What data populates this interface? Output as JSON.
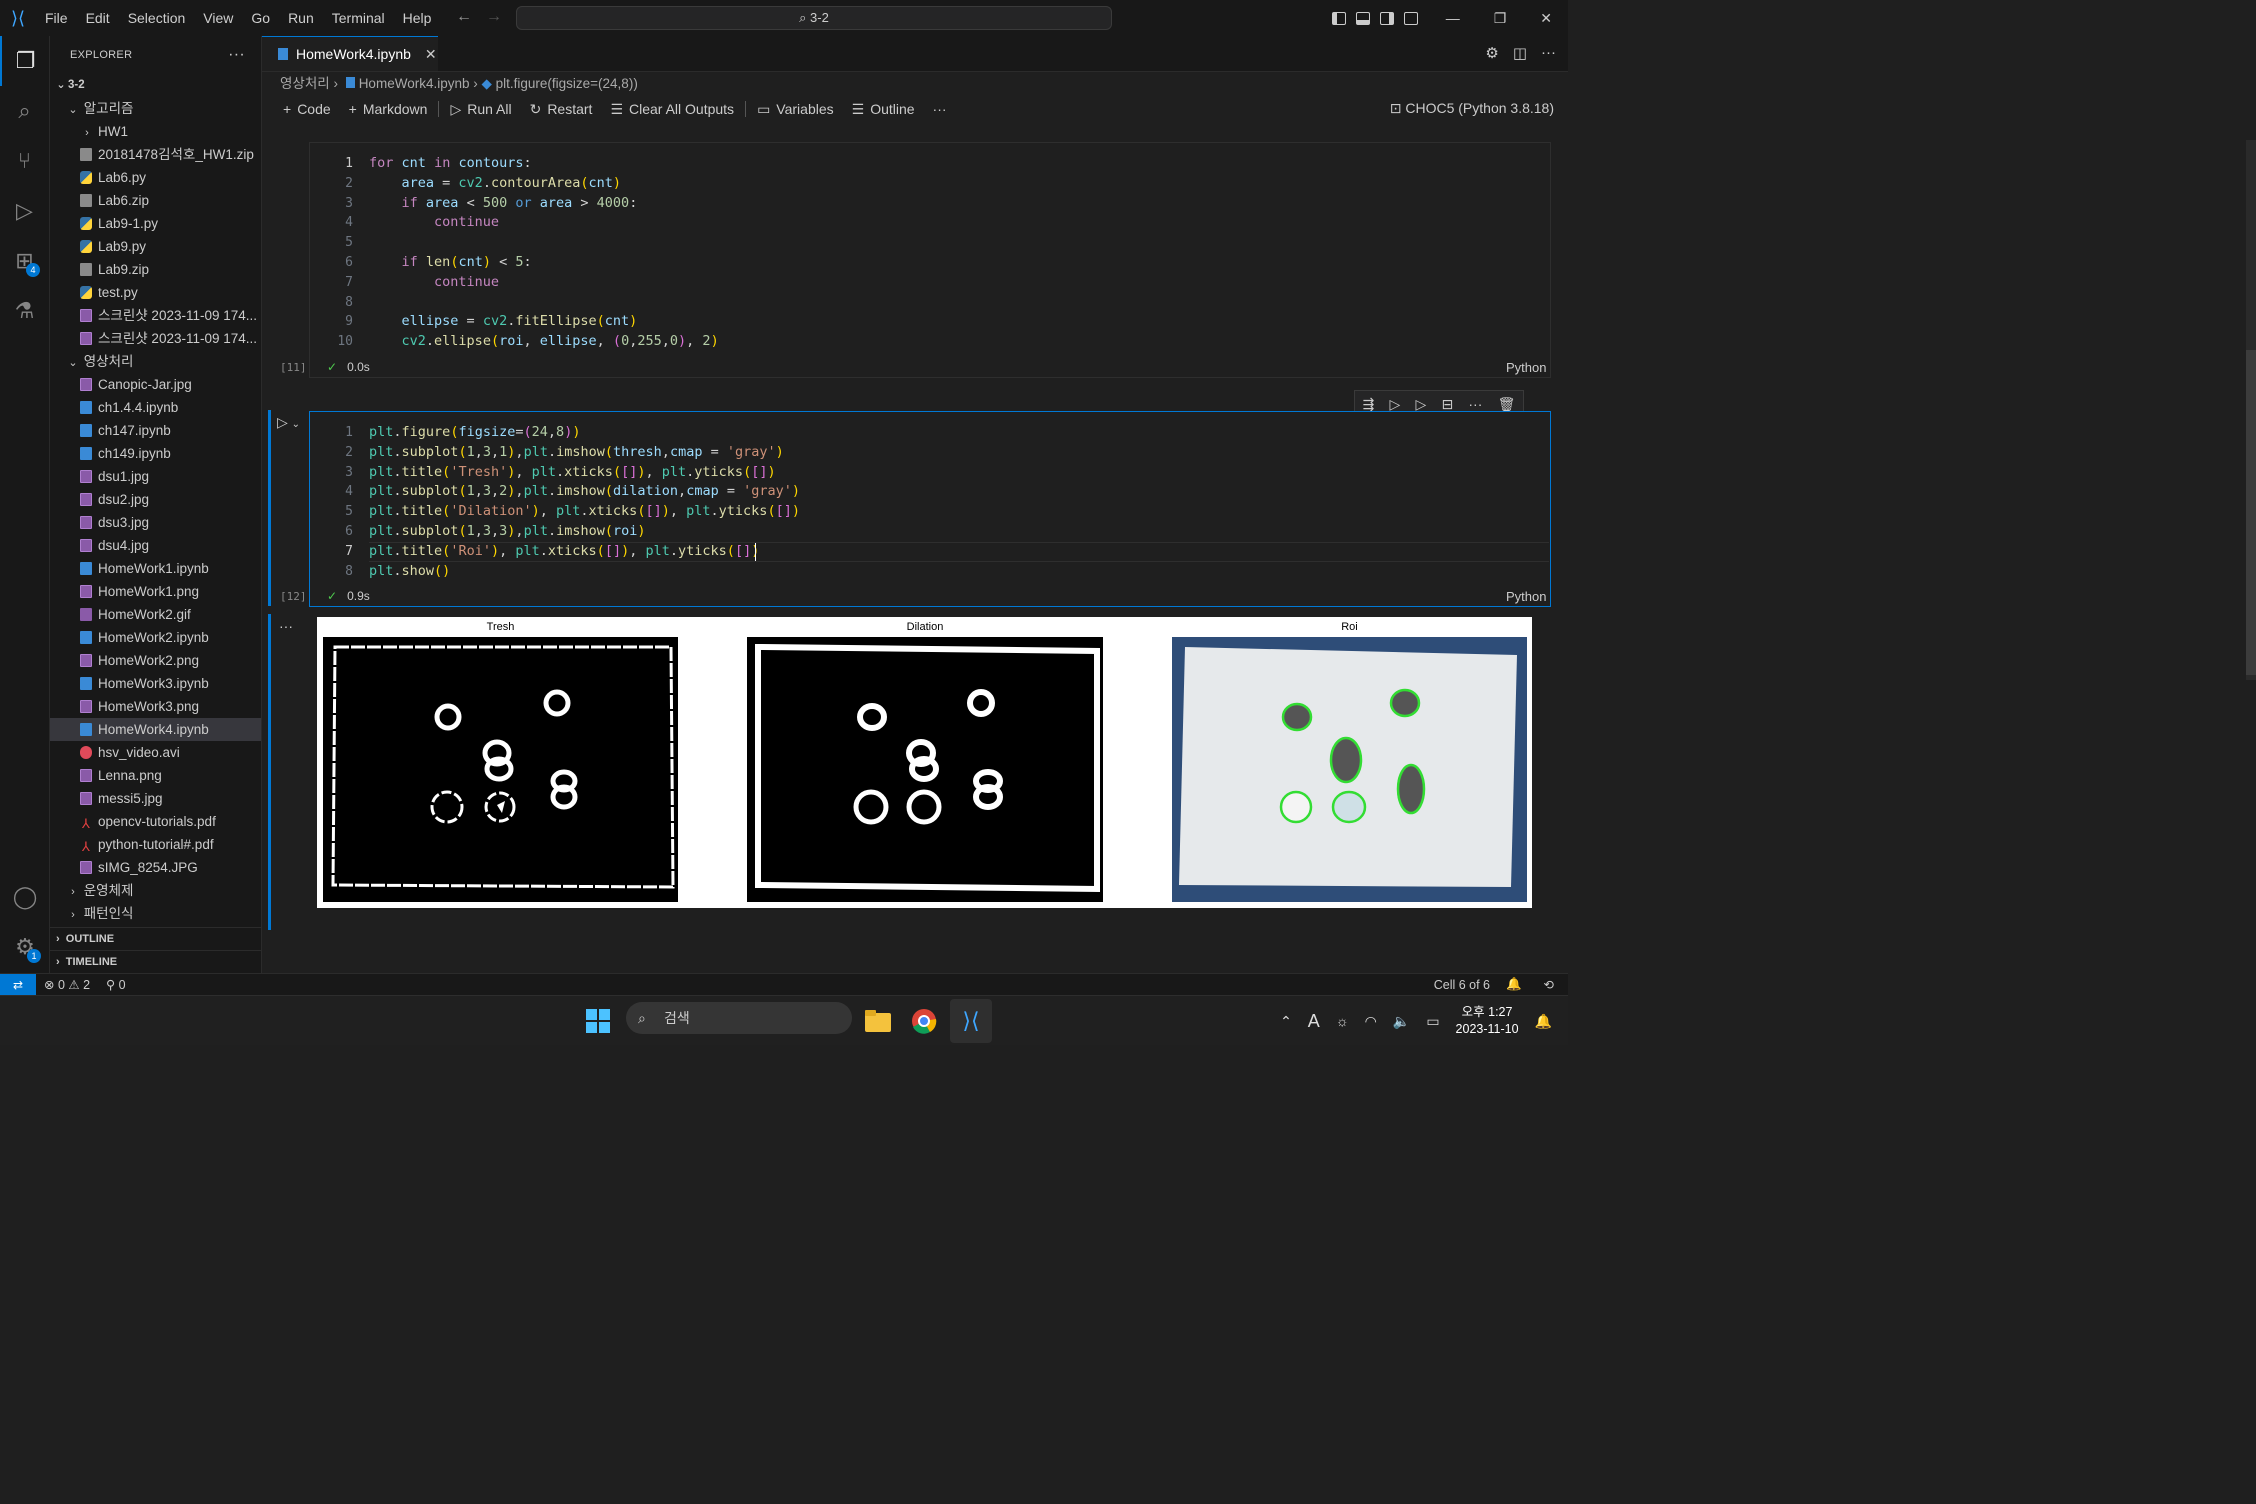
{
  "titlebar": {
    "menu": [
      "File",
      "Edit",
      "Selection",
      "View",
      "Go",
      "Run",
      "Terminal",
      "Help"
    ],
    "command_center": "3-2"
  },
  "activity": {
    "extensions_badge": "4",
    "settings_badge": "1"
  },
  "sidebar": {
    "title": "EXPLORER",
    "root": "3-2",
    "folder1": "알고리즘",
    "folder1_items": [
      {
        "name": "HW1",
        "type": "folder"
      },
      {
        "name": "20181478김석호_HW1.zip",
        "type": "zip"
      },
      {
        "name": "Lab6.py",
        "type": "py"
      },
      {
        "name": "Lab6.zip",
        "type": "zip"
      },
      {
        "name": "Lab9-1.py",
        "type": "py"
      },
      {
        "name": "Lab9.py",
        "type": "py"
      },
      {
        "name": "Lab9.zip",
        "type": "zip"
      },
      {
        "name": "test.py",
        "type": "py"
      },
      {
        "name": "스크린샷 2023-11-09 174...",
        "type": "img"
      },
      {
        "name": "스크린샷 2023-11-09 174...",
        "type": "img"
      }
    ],
    "folder2": "영상처리",
    "folder2_items": [
      {
        "name": "Canopic-Jar.jpg",
        "type": "img"
      },
      {
        "name": "ch1.4.4.ipynb",
        "type": "nb"
      },
      {
        "name": "ch147.ipynb",
        "type": "nb"
      },
      {
        "name": "ch149.ipynb",
        "type": "nb"
      },
      {
        "name": "dsu1.jpg",
        "type": "img"
      },
      {
        "name": "dsu2.jpg",
        "type": "img"
      },
      {
        "name": "dsu3.jpg",
        "type": "img"
      },
      {
        "name": "dsu4.jpg",
        "type": "img"
      },
      {
        "name": "HomeWork1.ipynb",
        "type": "nb"
      },
      {
        "name": "HomeWork1.png",
        "type": "img"
      },
      {
        "name": "HomeWork2.gif",
        "type": "gif"
      },
      {
        "name": "HomeWork2.ipynb",
        "type": "nb"
      },
      {
        "name": "HomeWork2.png",
        "type": "img"
      },
      {
        "name": "HomeWork3.ipynb",
        "type": "nb"
      },
      {
        "name": "HomeWork3.png",
        "type": "img"
      },
      {
        "name": "HomeWork4.ipynb",
        "type": "nb",
        "selected": true
      },
      {
        "name": "hsv_video.avi",
        "type": "avi"
      },
      {
        "name": "Lenna.png",
        "type": "img"
      },
      {
        "name": "messi5.jpg",
        "type": "img"
      },
      {
        "name": "opencv-tutorials.pdf",
        "type": "pdf"
      },
      {
        "name": "python-tutorial#.pdf",
        "type": "pdf"
      },
      {
        "name": "sIMG_8254.JPG",
        "type": "img"
      }
    ],
    "folder3": "운영체제",
    "folder4": "패턴인식",
    "outline": "OUTLINE",
    "timeline": "TIMELINE"
  },
  "tab": {
    "label": "HomeWork4.ipynb"
  },
  "breadcrumb": {
    "p1": "영상처리",
    "p2": "HomeWork4.ipynb",
    "p3": "plt.figure(figsize=(24,8))"
  },
  "toolbar": {
    "code": "Code",
    "markdown": "Markdown",
    "run_all": "Run All",
    "restart": "Restart",
    "clear": "Clear All Outputs",
    "variables": "Variables",
    "outline": "Outline",
    "kernel": "CHOC5 (Python 3.8.18)"
  },
  "cell1": {
    "exec": "[11]",
    "time": "0.0s",
    "lang": "Python"
  },
  "cell2": {
    "exec": "[12]",
    "time": "0.9s",
    "lang": "Python"
  },
  "plots": {
    "t1": "Tresh",
    "t2": "Dilation",
    "t3": "Roi"
  },
  "statusbar": {
    "errors": "0",
    "warnings": "2",
    "ports": "0",
    "cell": "Cell 6 of 6"
  },
  "taskbar": {
    "search": "검색",
    "time": "오후 1:27",
    "date": "2023-11-10"
  }
}
